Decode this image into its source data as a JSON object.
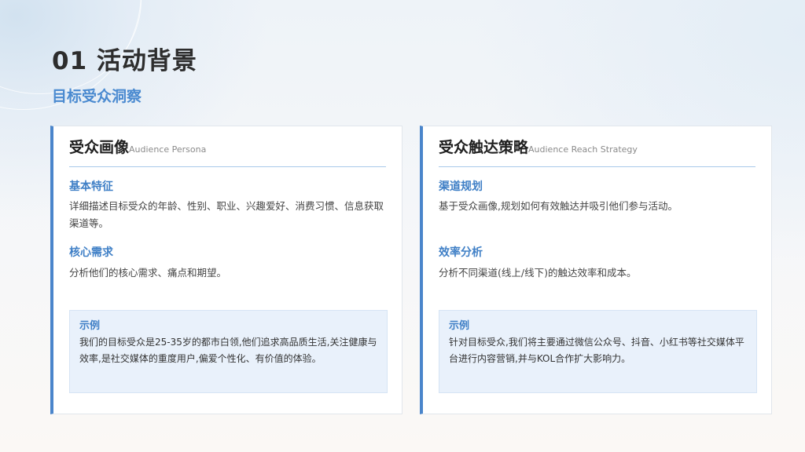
{
  "header": {
    "title": "01 活动背景",
    "subtitle": "目标受众洞察"
  },
  "cards": [
    {
      "title": "受众画像",
      "title_en": "Audience Persona",
      "sections": [
        {
          "heading": "基本特征",
          "text": "详细描述目标受众的年龄、性别、职业、兴趣爱好、消费习惯、信息获取渠道等。"
        },
        {
          "heading": "核心需求",
          "text": "分析他们的核心需求、痛点和期望。"
        }
      ],
      "example": {
        "heading": "示例",
        "text": "我们的目标受众是25-35岁的都市白领,他们追求高品质生活,关注健康与效率,是社交媒体的重度用户,偏爱个性化、有价值的体验。"
      }
    },
    {
      "title": "受众触达策略",
      "title_en": "Audience Reach Strategy",
      "sections": [
        {
          "heading": "渠道规划",
          "text": "基于受众画像,规划如何有效触达并吸引他们参与活动。"
        },
        {
          "heading": "效率分析",
          "text": "分析不同渠道(线上/线下)的触达效率和成本。"
        }
      ],
      "example": {
        "heading": "示例",
        "text": "针对目标受众,我们将主要通过微信公众号、抖音、小红书等社交媒体平台进行内容营销,并与KOL合作扩大影响力。"
      }
    }
  ],
  "colors": {
    "accent": "#4a85cb",
    "heading_blue": "#3f7fc6",
    "example_bg": "#e9f1fb"
  }
}
